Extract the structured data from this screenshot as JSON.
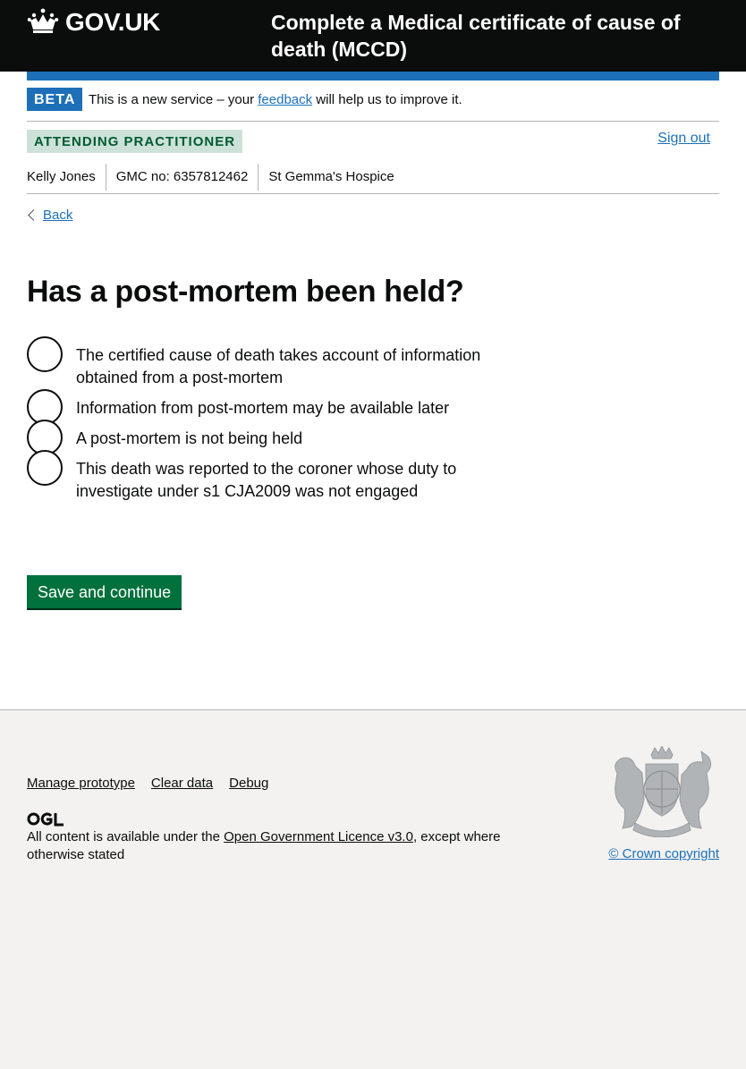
{
  "header": {
    "logo_text": "GOV.UK",
    "service_name": "Complete a Medical certificate of cause of death (MCCD)"
  },
  "phase_banner": {
    "tag": "BETA",
    "text_before": "This is a new service – your ",
    "link": "feedback",
    "text_after": " will help us to improve it."
  },
  "role": {
    "tag": "ATTENDING PRACTITIONER",
    "sign_out": "Sign out"
  },
  "user": {
    "name": "Kelly Jones",
    "gmc": "GMC no: 6357812462",
    "organisation": "St Gemma's Hospice"
  },
  "back_label": "Back",
  "question": "Has a post-mortem been held?",
  "options": [
    {
      "label": "The certified cause of death takes account of information obtained from a post-mortem",
      "selected": false
    },
    {
      "label": "Information from post-mortem may be available later",
      "selected": false
    },
    {
      "label": "A post-mortem is not being held",
      "selected": false
    },
    {
      "label": "This death was reported to the coroner whose duty to investigate under s1 CJA2009 was not engaged",
      "selected": false
    }
  ],
  "submit_label": "Save and continue",
  "footer": {
    "links": [
      "Manage prototype",
      "Clear data",
      "Debug"
    ],
    "ogl_logo_text": "OGL",
    "license_before": "All content is available under the ",
    "license_link": "Open Government Licence v3.0",
    "license_after": ", except where otherwise stated",
    "copyright": "© Crown copyright"
  },
  "colors": {
    "header_bg": "#0b0c0c",
    "brand_blue": "#1d70b8",
    "button_green": "#00703c",
    "role_tag_bg": "#cce2d8",
    "role_tag_text": "#005a30",
    "footer_bg": "#f3f2f1"
  },
  "icons": {
    "logo": "crown-icon",
    "back": "chevron-left-icon",
    "crest": "royal-coat-of-arms-icon"
  }
}
